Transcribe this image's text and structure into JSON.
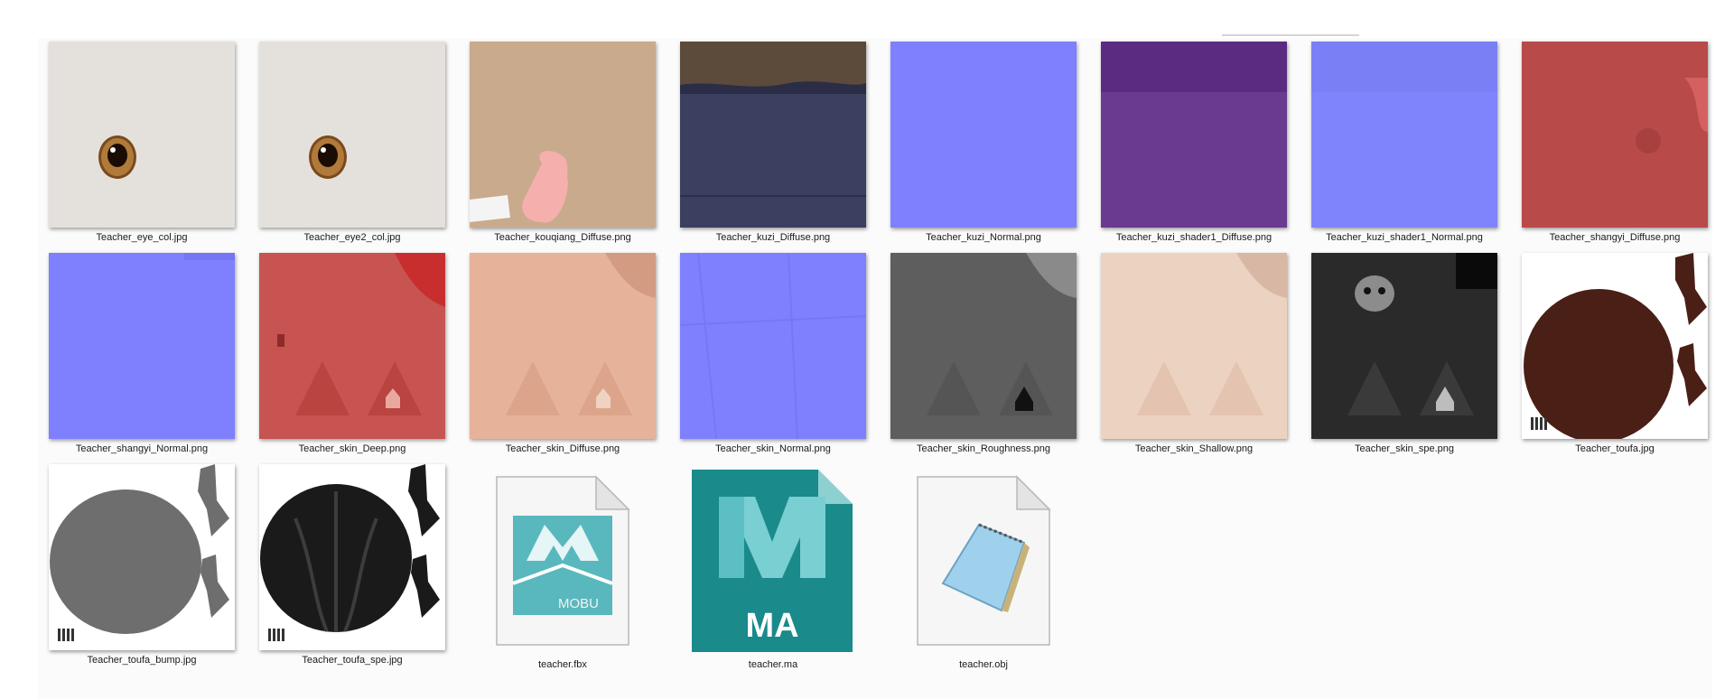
{
  "files": [
    {
      "name": "Teacher_eye_col.jpg"
    },
    {
      "name": "Teacher_eye2_col.jpg"
    },
    {
      "name": "Teacher_kouqiang_Diffuse.png"
    },
    {
      "name": "Teacher_kuzi_Diffuse.png"
    },
    {
      "name": "Teacher_kuzi_Normal.png"
    },
    {
      "name": "Teacher_kuzi_shader1_Diffuse.png"
    },
    {
      "name": "Teacher_kuzi_shader1_Normal.png"
    },
    {
      "name": "Teacher_shangyi_Diffuse.png"
    },
    {
      "name": "Teacher_shangyi_Normal.png"
    },
    {
      "name": "Teacher_skin_Deep.png"
    },
    {
      "name": "Teacher_skin_Diffuse.png"
    },
    {
      "name": "Teacher_skin_Normal.png"
    },
    {
      "name": "Teacher_skin_Roughness.png"
    },
    {
      "name": "Teacher_skin_Shallow.png"
    },
    {
      "name": "Teacher_skin_spe.png"
    },
    {
      "name": "Teacher_toufa.jpg"
    },
    {
      "name": "Teacher_toufa_bump.jpg"
    },
    {
      "name": "Teacher_toufa_spe.jpg"
    },
    {
      "name": "teacher.fbx",
      "icon_text": "MOBU"
    },
    {
      "name": "teacher.ma",
      "icon_text": "MA"
    },
    {
      "name": "teacher.obj"
    }
  ],
  "colors": {
    "normal_map": "#7f80fd",
    "skin_deep": "#c75450",
    "skin_diffuse": "#e6b39a",
    "skin_shallow": "#ecd2c0",
    "kuzi_diffuse": "#3b3f60",
    "kuzi_shader1": "#6a3a91",
    "shangyi_diffuse": "#b84a4a",
    "eye_background": "#e4e1dd",
    "hair_brown": "#4a1f16",
    "maya_teal": "#1a8a8b"
  }
}
